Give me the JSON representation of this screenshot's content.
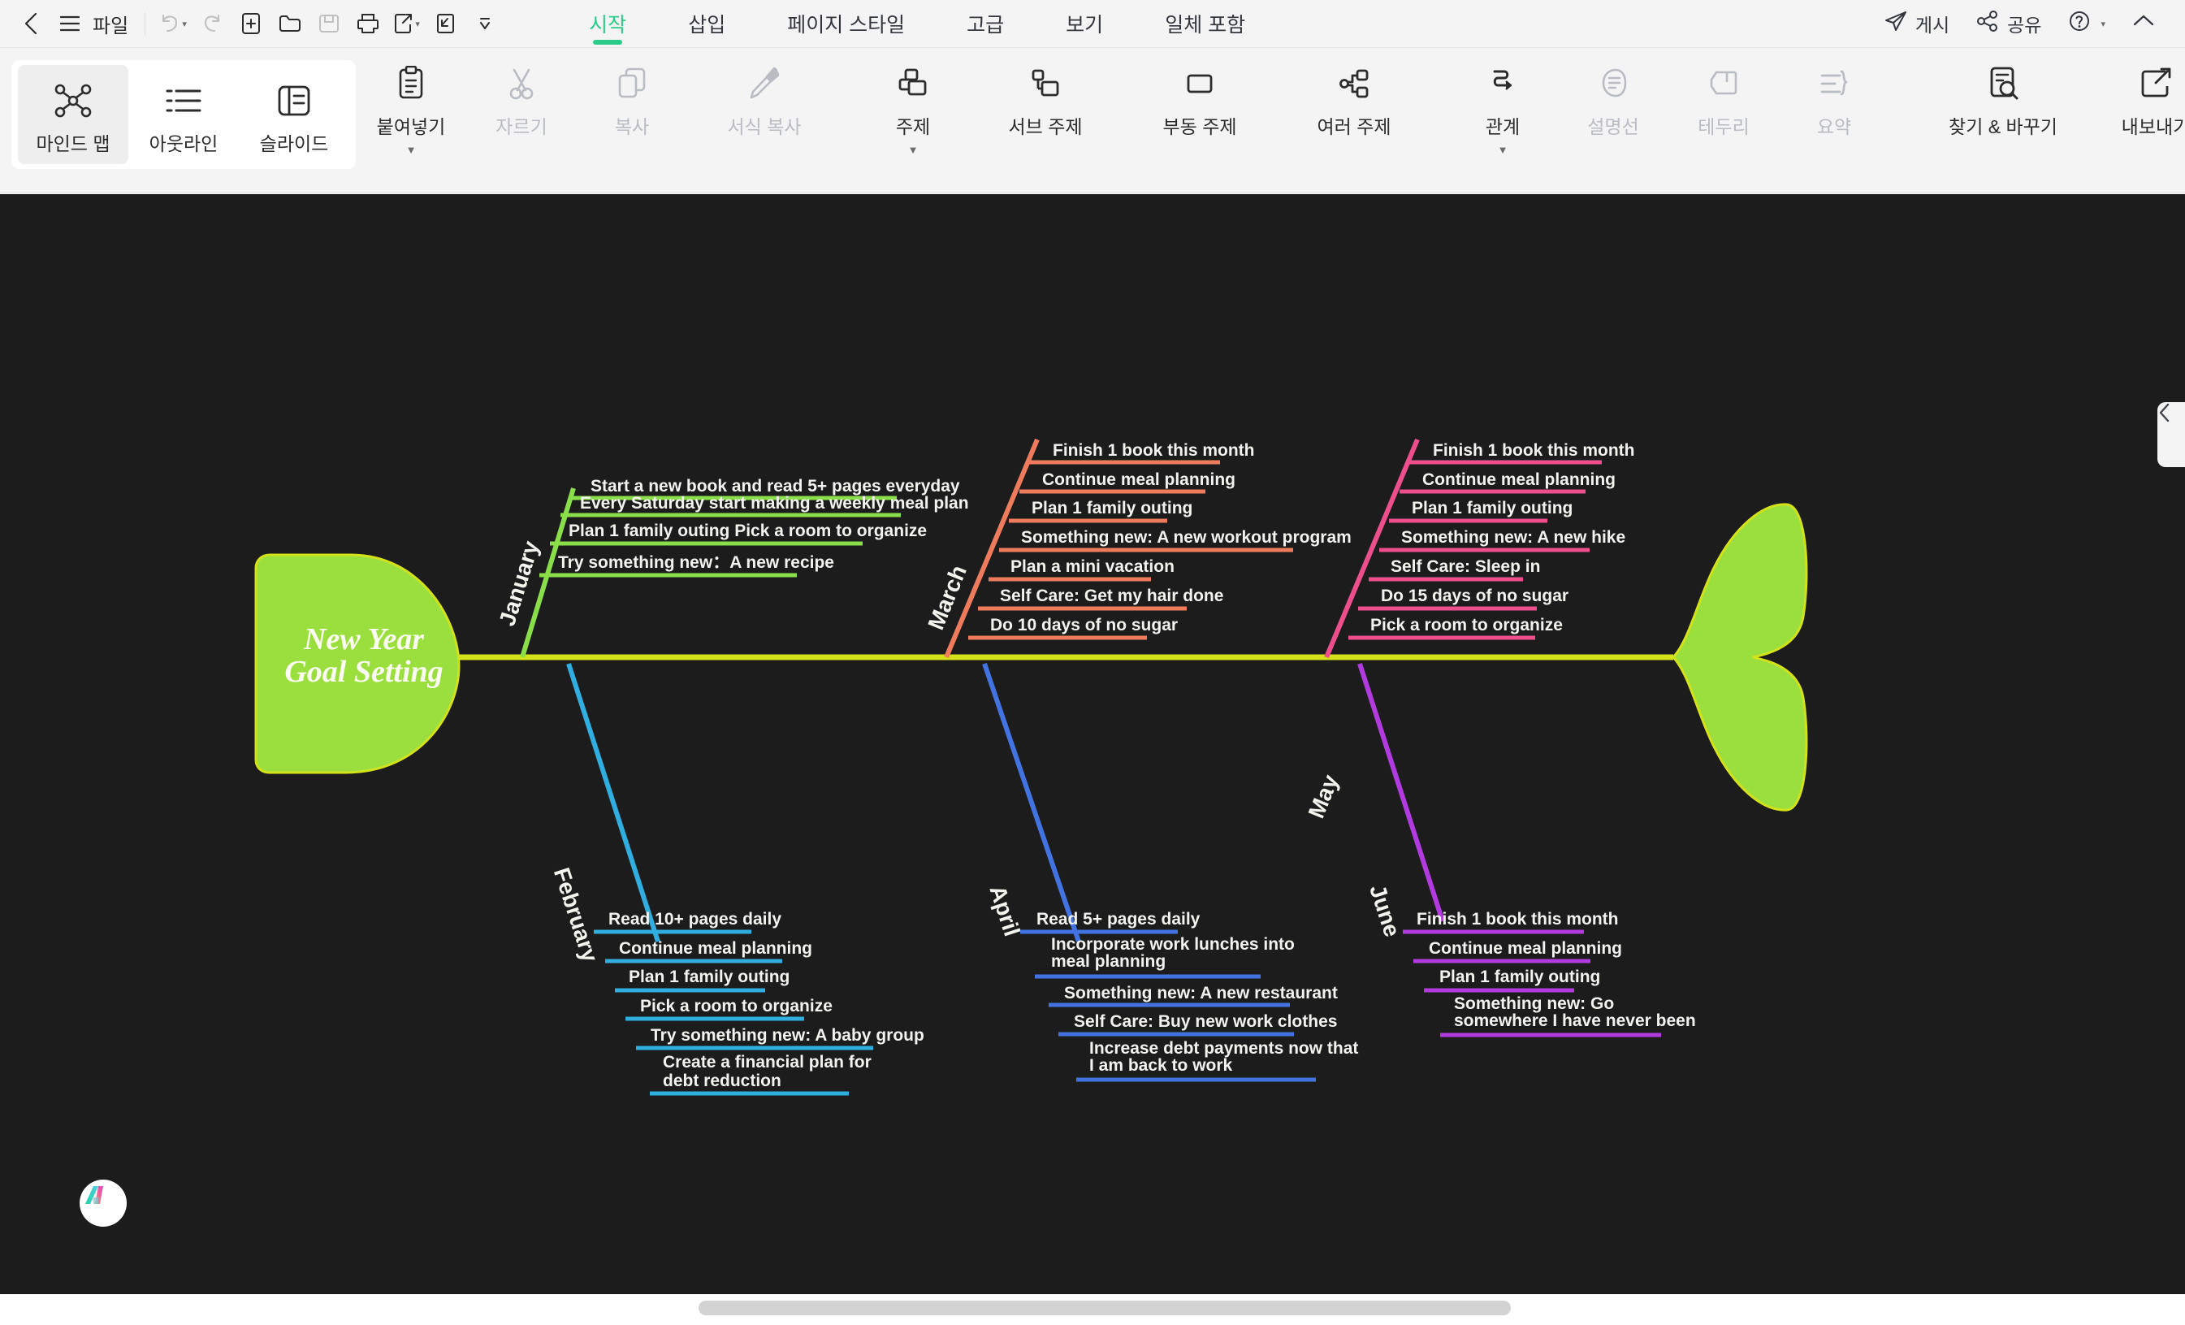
{
  "menubar": {
    "file_label": "파일",
    "tabs": [
      {
        "label": "시작",
        "active": true
      },
      {
        "label": "삽입",
        "active": false
      },
      {
        "label": "페이지 스타일",
        "active": false
      },
      {
        "label": "고급",
        "active": false
      },
      {
        "label": "보기",
        "active": false
      },
      {
        "label": "일체 포함",
        "active": false
      }
    ],
    "right": [
      {
        "label": "게시",
        "icon": "send-icon"
      },
      {
        "label": "공유",
        "icon": "share-icon"
      },
      {
        "label": "",
        "icon": "help-icon"
      },
      {
        "label": "",
        "icon": "chevron-up-icon"
      }
    ]
  },
  "ribbon": {
    "views": [
      {
        "label": "마인드 맵",
        "icon": "mindmap-icon",
        "selected": true,
        "disabled": false
      },
      {
        "label": "아웃라인",
        "icon": "outline-icon",
        "selected": false,
        "disabled": false
      },
      {
        "label": "슬라이드",
        "icon": "slide-icon",
        "selected": false,
        "disabled": false
      }
    ],
    "clipboard": [
      {
        "label": "붙여넣기",
        "icon": "paste-icon",
        "disabled": false,
        "caret": true
      },
      {
        "label": "자르기",
        "icon": "scissors-icon",
        "disabled": true,
        "caret": false
      },
      {
        "label": "복사",
        "icon": "copy-icon",
        "disabled": true,
        "caret": false
      },
      {
        "label": "서식 복사",
        "icon": "format-painter-icon",
        "disabled": true,
        "caret": false
      }
    ],
    "topics": [
      {
        "label": "주제",
        "icon": "topic-icon",
        "disabled": false,
        "caret": true
      },
      {
        "label": "서브 주제",
        "icon": "subtopic-icon",
        "disabled": false,
        "caret": false
      },
      {
        "label": "부동 주제",
        "icon": "floating-topic-icon",
        "disabled": false,
        "caret": false
      },
      {
        "label": "여러 주제",
        "icon": "multi-topic-icon",
        "disabled": false,
        "caret": false
      }
    ],
    "annotations": [
      {
        "label": "관계",
        "icon": "relationship-icon",
        "disabled": false,
        "caret": true
      },
      {
        "label": "설명선",
        "icon": "callout-icon",
        "disabled": true,
        "caret": false
      },
      {
        "label": "테두리",
        "icon": "boundary-icon",
        "disabled": true,
        "caret": false
      },
      {
        "label": "요약",
        "icon": "summary-icon",
        "disabled": true,
        "caret": false
      }
    ],
    "find": [
      {
        "label": "찾기 & 바꾸기",
        "icon": "find-replace-icon",
        "disabled": false,
        "caret": false
      }
    ],
    "export": {
      "label": "내보내기",
      "icon": "export-icon"
    }
  },
  "colors": {
    "accent_green": "#2bcc8a",
    "spine": "#d4e21a",
    "head_fill": "#9bdf3f",
    "canvas_bg": "#1c1c1c",
    "january": "#8ade4a",
    "february": "#31aee0",
    "march": "#ee7c5c",
    "april": "#4273e0",
    "may": "#ec4f8c",
    "june": "#b23be0"
  },
  "chart_data": {
    "type": "diagram",
    "diagram_kind": "fishbone",
    "title": "New Year\nGoal Setting",
    "head_line1": "New Year",
    "head_line2": "Goal Setting",
    "branches": [
      {
        "month": "January",
        "side": "top",
        "color": "#8ade4a",
        "items": [
          "Start a new book and read 5+ pages everyday",
          "Every Saturday start making a weekly meal plan",
          "Plan 1 family outing Pick a room to organize",
          "Try something new：A new recipe"
        ]
      },
      {
        "month": "February",
        "side": "bottom",
        "color": "#31aee0",
        "items": [
          "Read 10+ pages daily",
          "Continue meal planning",
          "Plan 1 family outing",
          "Pick a room to organize",
          "Try something new: A baby group",
          "Create a financial plan for\ndebt reduction"
        ]
      },
      {
        "month": "March",
        "side": "top",
        "color": "#ee7c5c",
        "items": [
          "Finish 1 book this month",
          "Continue meal planning",
          "Plan 1 family outing",
          "Something new: A new workout program",
          "Plan a mini vacation",
          "Self Care: Get my hair done",
          "Do 10 days of no sugar"
        ]
      },
      {
        "month": "April",
        "side": "bottom",
        "color": "#4273e0",
        "items": [
          "Read 5+ pages daily",
          "Incorporate work lunches into\nmeal planning",
          "Something new: A new restaurant",
          "Self Care: Buy new work clothes",
          "Increase debt payments now that\nI am back to work"
        ]
      },
      {
        "month": "May",
        "side": "top",
        "color": "#ec4f8c",
        "items": [
          "Finish 1 book this month",
          "Continue meal planning",
          "Plan 1 family outing",
          "Something new: A new hike",
          "Self Care: Sleep in",
          "Do 15 days of no sugar",
          "Pick a room to organize"
        ]
      },
      {
        "month": "June",
        "side": "bottom",
        "color": "#b23be0",
        "items": [
          "Finish 1 book this month",
          "Continue meal planning",
          "Plan 1 family outing",
          "Something new: Go\nsomewhere I have never been"
        ]
      }
    ]
  }
}
